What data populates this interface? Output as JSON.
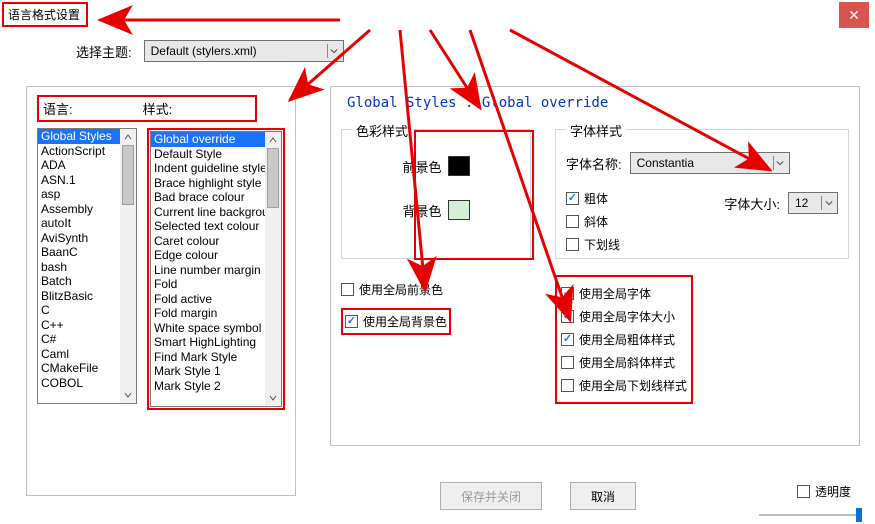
{
  "window": {
    "title": "语言格式设置"
  },
  "theme": {
    "label": "选择主题:",
    "value": "Default (stylers.xml)"
  },
  "headers": {
    "language": "语言:",
    "style": "样式:"
  },
  "langs": [
    "Global Styles",
    "ActionScript",
    "ADA",
    "ASN.1",
    "asp",
    "Assembly",
    "autoIt",
    "AviSynth",
    "BaanC",
    "bash",
    "Batch",
    "BlitzBasic",
    "C",
    "C++",
    "C#",
    "Caml",
    "CMakeFile",
    "COBOL"
  ],
  "lang_selected": 0,
  "styles": [
    "Global override",
    "Default Style",
    "Indent guideline style",
    "Brace highlight style",
    "Bad brace colour",
    "Current line background",
    "Selected text colour",
    "Caret colour",
    "Edge colour",
    "Line number margin",
    "Fold",
    "Fold active",
    "Fold margin",
    "White space symbol",
    "Smart HighLighting",
    "Find Mark Style",
    "Mark Style 1",
    "Mark Style 2"
  ],
  "style_selected": 0,
  "breadcrumb": "Global Styles : Global override",
  "color": {
    "legend": "色彩样式",
    "fg": "前景色",
    "bg": "背景色",
    "use_fg": "使用全局前景色",
    "use_bg": "使用全局背景色",
    "use_fg_checked": false,
    "use_bg_checked": true
  },
  "font": {
    "legend": "字体样式",
    "name_label": "字体名称:",
    "name_value": "Constantia",
    "size_label": "字体大小:",
    "size_value": "12",
    "bold": "粗体",
    "bold_checked": true,
    "italic": "斜体",
    "italic_checked": false,
    "underline": "下划线",
    "underline_checked": false,
    "use_font": "使用全局字体",
    "use_font_checked": true,
    "use_size": "使用全局字体大小",
    "use_size_checked": true,
    "use_bold": "使用全局粗体样式",
    "use_bold_checked": true,
    "use_italic": "使用全局斜体样式",
    "use_italic_checked": false,
    "use_under": "使用全局下划线样式",
    "use_under_checked": false
  },
  "buttons": {
    "save": "保存并关闭",
    "cancel": "取消"
  },
  "transparent": "透明度"
}
